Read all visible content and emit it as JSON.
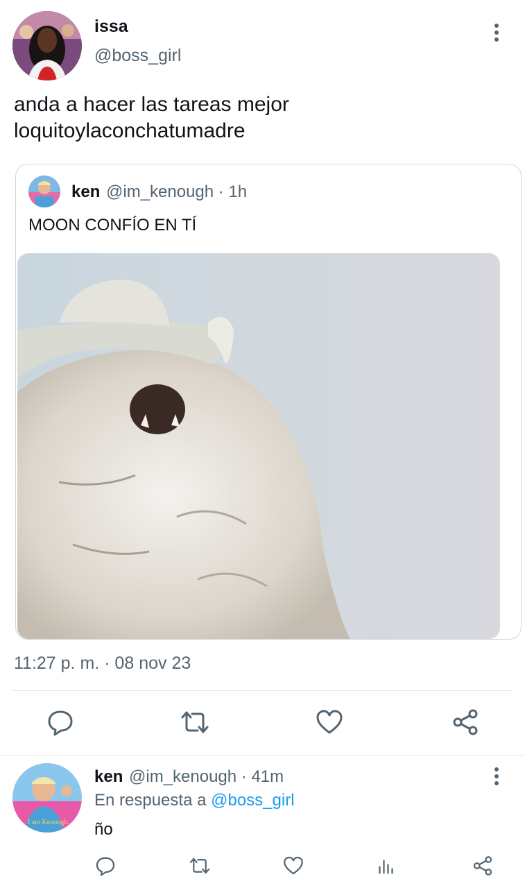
{
  "tweet": {
    "author_name": "issa",
    "author_handle": "@boss_girl",
    "text_line1": "anda a hacer las tareas mejor",
    "text_line2": "loquitoylaconchatumadre",
    "timestamp": "11:27 p. m. · 08 nov 23"
  },
  "quoted_tweet": {
    "author_name": "ken",
    "meta": "@im_kenough · 1h",
    "text": "MOON CONFÍO EN TÍ"
  },
  "reply": {
    "author_name": "ken",
    "meta": "@im_kenough · 41m",
    "replying_prefix": "En respuesta a ",
    "replying_to": "@boss_girl",
    "text": "ño",
    "avatar_caption": "I am Kenough."
  },
  "icons": {
    "reply": "reply-icon",
    "retweet": "retweet-icon",
    "like": "heart-icon",
    "share": "share-icon",
    "views": "views-icon",
    "more": "more-vertical-icon"
  },
  "colors": {
    "text_primary": "#0f1419",
    "text_secondary": "#536471",
    "accent": "#1d9bf0",
    "border": "#cfd9de"
  }
}
